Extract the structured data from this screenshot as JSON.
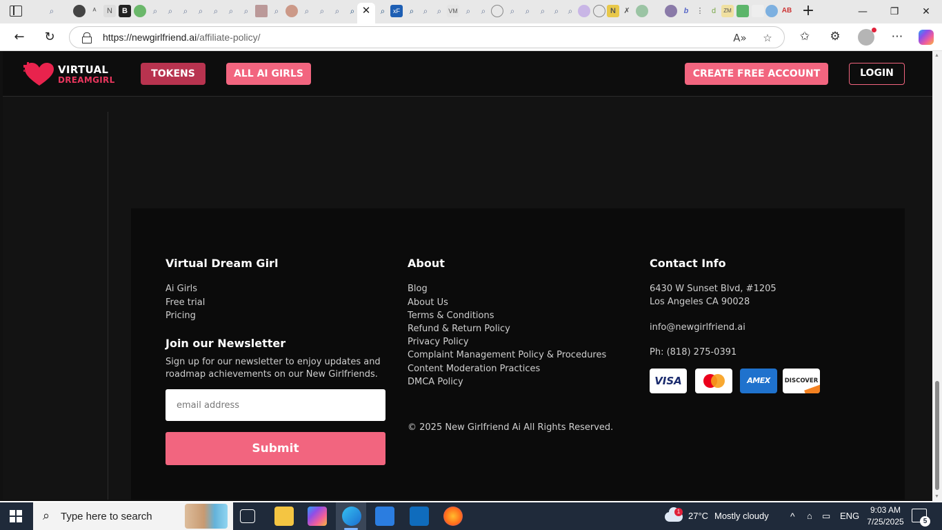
{
  "browser": {
    "url_domain": "https://newgirlfriend.ai",
    "url_path": "/affiliate-policy/",
    "tab_close_glyph": "✕",
    "new_tab_glyph": "+",
    "window_controls": [
      "—",
      "❐",
      "✕"
    ]
  },
  "site_header": {
    "logo_line1": "VIRTUAL",
    "logo_line2": "DREAMGIRL",
    "tokens_label": "TOKENS",
    "all_girls_label": "ALL AI GIRLS",
    "create_account_label": "CREATE FREE ACCOUNT",
    "login_label": "LOGIN",
    "brand_colors": {
      "primary": "#f2657f",
      "dark": "#b8334f"
    }
  },
  "footer": {
    "col1": {
      "heading": "Virtual Dream Girl",
      "links": [
        "Ai Girls",
        "Free trial",
        "Pricing"
      ],
      "newsletter_heading": "Join our Newsletter",
      "newsletter_text_line1": "Sign up for our newsletter to enjoy updates and",
      "newsletter_text_line2": "roadmap achievements on our New Girlfriends.",
      "email_placeholder": "email address",
      "submit_label": "Submit"
    },
    "col2": {
      "heading": "About",
      "links": [
        "Blog",
        "About Us",
        "Terms & Conditions",
        "Refund & Return Policy",
        "Privacy Policy",
        "Complaint Management Policy & Procedures",
        "Content Moderation Practices",
        "DMCA Policy"
      ],
      "copyright": "© 2025 New Girlfriend Ai All Rights Reserved."
    },
    "col3": {
      "heading": "Contact Info",
      "address_line1": "6430 W Sunset Blvd, #1205",
      "address_line2": "Los Angeles CA 90028",
      "email": "info@newgirlfriend.ai",
      "phone": "Ph: (818) 275-0391",
      "payment_cards": [
        "VISA",
        "mastercard",
        "AMEX",
        "DISCOVER"
      ]
    }
  },
  "taskbar": {
    "search_placeholder": "Type here to search",
    "weather_temp": "27°C",
    "weather_desc": "Mostly cloudy",
    "weather_badge": "1",
    "language": "ENG",
    "time": "9:03 AM",
    "date": "7/25/2025",
    "notification_count": "5"
  }
}
